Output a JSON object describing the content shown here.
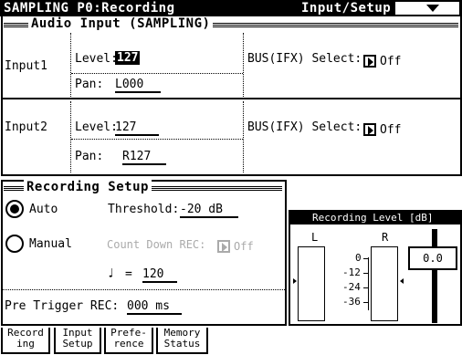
{
  "header": {
    "title": "SAMPLING P0:Recording",
    "page_menu": "Input/Setup"
  },
  "audio_input": {
    "title": "Audio Input (SAMPLING)",
    "inputs": [
      {
        "label": "Input1",
        "level_label": "Level:",
        "level": "127",
        "pan_label": "Pan:",
        "pan": "L000",
        "bus_label": "BUS(IFX) Select:",
        "bus": "Off"
      },
      {
        "label": "Input2",
        "level_label": "Level:",
        "level": "127",
        "pan_label": "Pan:",
        "pan": "R127",
        "bus_label": "BUS(IFX) Select:",
        "bus": "Off"
      }
    ]
  },
  "recording_setup": {
    "title": "Recording Setup",
    "auto_label": "Auto",
    "manual_label": "Manual",
    "mode_selected": "Auto",
    "threshold_label": "Threshold:",
    "threshold": "-20 dB",
    "countdown_label": "Count Down REC:",
    "countdown": "Off",
    "tempo_symbol": "♩",
    "tempo_eq": "=",
    "tempo": "120",
    "pretrigger_label": "Pre Trigger REC:",
    "pretrigger": "000 ms"
  },
  "recording_level": {
    "title": "Recording Level [dB]",
    "left_label": "L",
    "right_label": "R",
    "scale": [
      "0",
      "-12",
      "-24",
      "-36"
    ],
    "value": "0.0"
  },
  "tabs": [
    {
      "line1": "Record",
      "line2": "ing"
    },
    {
      "line1": "Input",
      "line2": "Setup"
    },
    {
      "line1": "Prefe-",
      "line2": "rence"
    },
    {
      "line1": "Memory",
      "line2": "Status"
    }
  ],
  "colors": {
    "foreground": "#000000",
    "background": "#ffffff"
  },
  "icons": {
    "page_menu": "triangle-down-icon",
    "bus_select": "triangle-right-icon"
  }
}
